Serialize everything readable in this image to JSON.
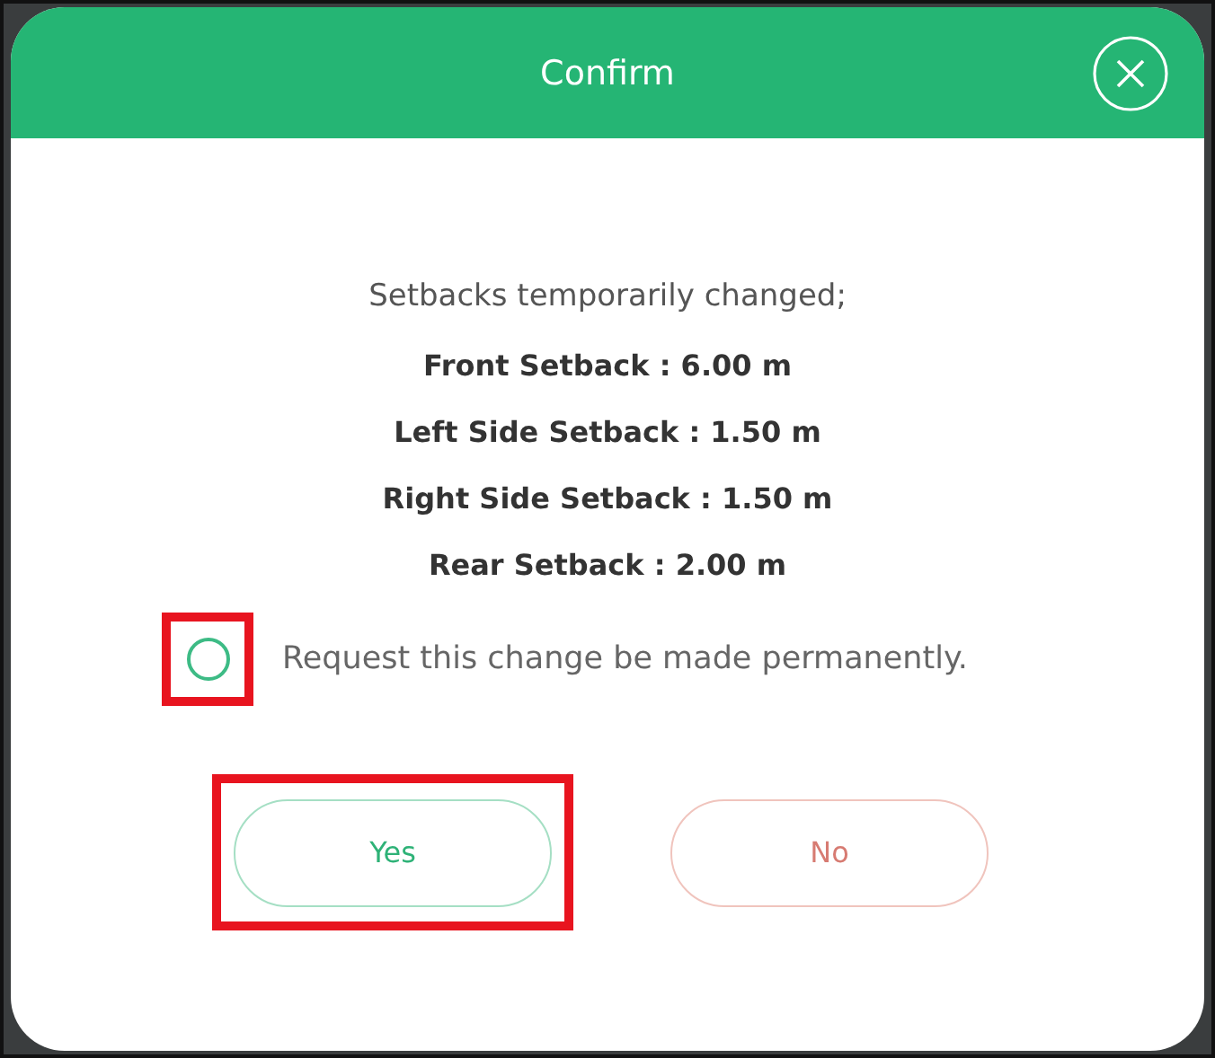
{
  "dialog": {
    "title": "Confirm"
  },
  "message": {
    "intro": "Setbacks temporarily changed;",
    "lines": [
      "Front Setback : 6.00 m",
      "Left Side Setback : 1.50 m",
      "Right Side Setback : 1.50 m",
      "Rear Setback : 2.00 m"
    ]
  },
  "option": {
    "label": "Request this change be made permanently.",
    "checked": false,
    "highlighted": true
  },
  "buttons": [
    {
      "label": "Yes",
      "kind": "confirm",
      "highlighted": true
    },
    {
      "label": "No",
      "kind": "cancel",
      "highlighted": false
    }
  ]
}
